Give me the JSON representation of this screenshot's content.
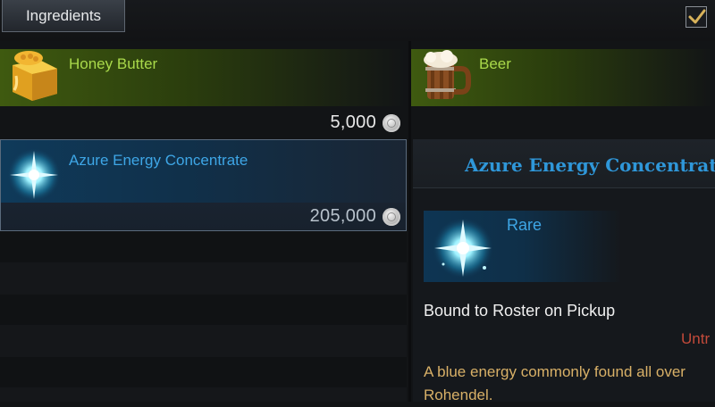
{
  "header": {
    "tab_label": "Ingredients",
    "checkbox_checked": true
  },
  "items": [
    {
      "name": "Honey Butter",
      "price": "5,000",
      "grade_color": "#a9d94a",
      "icon": "honey-butter-icon"
    },
    {
      "name": "Beer",
      "grade_color": "#a9d94a",
      "icon": "beer-mug-icon"
    },
    {
      "name": "Azure Energy Concentrate",
      "price": "205,000",
      "grade_color": "#3ea6e6",
      "icon": "azure-energy-icon",
      "selected": true
    }
  ],
  "detail": {
    "title": "Azure Energy Concentrat",
    "rarity": "Rare",
    "binding": "Bound to Roster on Pickup",
    "trade_status": "Untr",
    "description": "A blue energy commonly found all over Rohendel."
  },
  "currency_icon": "silver-coin-icon"
}
